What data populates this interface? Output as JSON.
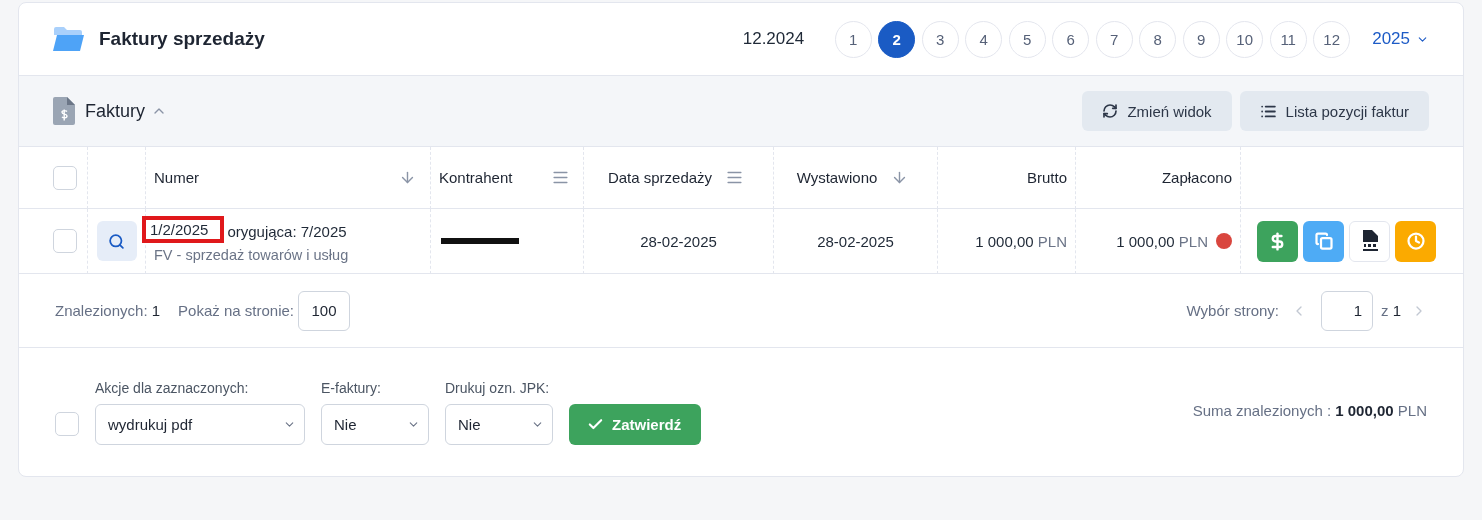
{
  "header": {
    "title": "Faktury sprzedaży",
    "previous_period": "12.2024",
    "months": [
      {
        "label": "1",
        "selected": false
      },
      {
        "label": "2",
        "selected": true
      },
      {
        "label": "3",
        "selected": false
      },
      {
        "label": "4",
        "selected": false
      },
      {
        "label": "5",
        "selected": false
      },
      {
        "label": "6",
        "selected": false
      },
      {
        "label": "7",
        "selected": false
      },
      {
        "label": "8",
        "selected": false
      },
      {
        "label": "9",
        "selected": false
      },
      {
        "label": "10",
        "selected": false
      },
      {
        "label": "11",
        "selected": false
      },
      {
        "label": "12",
        "selected": false
      }
    ],
    "year": "2025"
  },
  "section": {
    "title": "Faktury",
    "expanded": true,
    "buttons": [
      {
        "label": "Zmień widok",
        "kind": "refresh"
      },
      {
        "label": "Lista pozycji faktur",
        "kind": "list"
      }
    ]
  },
  "table": {
    "select_all_checked": false,
    "columns": [
      {
        "label": "Numer",
        "kind": "sort"
      },
      {
        "label": "Kontrahent",
        "kind": "filter"
      },
      {
        "label": "Data sprzedaży",
        "kind": "filter"
      },
      {
        "label": "Wystawiono",
        "kind": "sort"
      },
      {
        "label": "Brutto",
        "kind": "plain"
      },
      {
        "label": "Zapłacono",
        "kind": "plain"
      }
    ],
    "rows": [
      {
        "checked": false,
        "number": "1/2/2025",
        "number_marked": true,
        "note": "orygująca: 7/2025",
        "type": "FV - sprzedaż towarów i usług",
        "contractor_redacted": true,
        "sale_date": "28-02-2025",
        "issued": "28-02-2025",
        "gross": {
          "amount": "1 000,00",
          "currency": "PLN"
        },
        "paid": {
          "amount": "1 000,00",
          "currency": "PLN",
          "color": "#d9463e"
        }
      }
    ]
  },
  "pagination": {
    "found_label": "Znalezionych:",
    "found": "1",
    "per_page_label": "Pokaż na stronie:",
    "per_page": "100",
    "page_label": "Wybór strony:",
    "page": "1",
    "of": "z",
    "pages": "1"
  },
  "footer": {
    "select_checked": false,
    "selects": [
      {
        "label": "Akcje dla zaznaczonych:",
        "value": "wydrukuj pdf"
      },
      {
        "label": "E-faktury:",
        "value": "Nie"
      },
      {
        "label": "Drukuj ozn. JPK:",
        "value": "Nie"
      }
    ],
    "submit": "Zatwierdź",
    "sum_label": "Suma znalezionych :",
    "sum_amount": "1 000,00",
    "sum_currency": "PLN"
  }
}
